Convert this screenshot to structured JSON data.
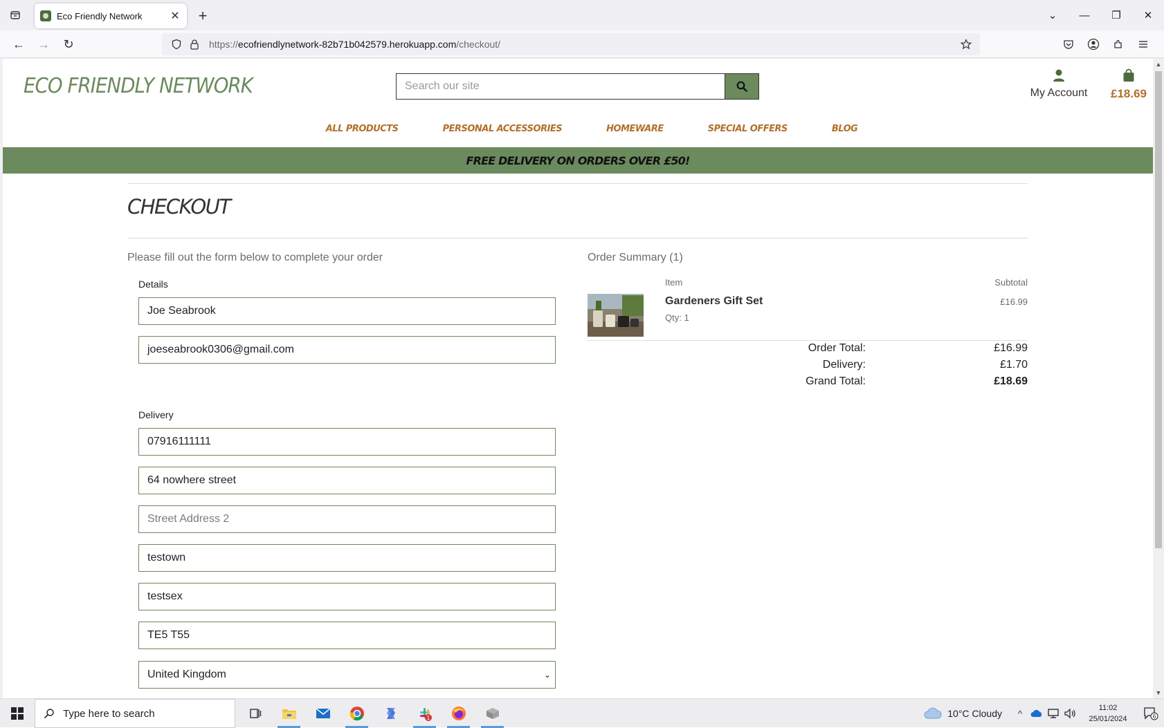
{
  "browser": {
    "tab_title": "Eco Friendly Network",
    "url_prefix": "https://",
    "url_host": "ecofriendlynetwork-82b71b042579.herokuapp.com",
    "url_path": "/checkout/"
  },
  "site": {
    "logo": "ECO FRIENDLY NETWORK",
    "search_placeholder": "Search our site",
    "account_label": "My Account",
    "bag_total": "£18.69",
    "nav": [
      "ALL PRODUCTS",
      "PERSONAL ACCESSORIES",
      "HOMEWARE",
      "SPECIAL OFFERS",
      "BLOG"
    ],
    "banner": "FREE DELIVERY ON ORDERS OVER £50!",
    "brand_color": "#6b8a5e",
    "accent_color": "#b2702a"
  },
  "checkout": {
    "title": "CHECKOUT",
    "intro": "Please fill out the form below to complete your order",
    "details_label": "Details",
    "full_name": "Joe Seabrook",
    "email": "joeseabrook0306@gmail.com",
    "delivery_label": "Delivery",
    "phone": "07916111111",
    "street1": "64 nowhere street",
    "street2_placeholder": "Street Address 2",
    "town": "testown",
    "county": "testsex",
    "postcode": "TE5 T55",
    "country": "United Kingdom"
  },
  "summary": {
    "title": "Order Summary (1)",
    "item_header": "Item",
    "subtotal_header": "Subtotal",
    "product_name": "Gardeners Gift Set",
    "product_qty": "Qty: 1",
    "product_subtotal": "£16.99",
    "order_total_label": "Order Total:",
    "order_total": "£16.99",
    "delivery_label": "Delivery:",
    "delivery": "£1.70",
    "grand_total_label": "Grand Total:",
    "grand_total": "£18.69"
  },
  "taskbar": {
    "search_text": "Type here to search",
    "weather": "10°C  Cloudy",
    "time": "11:02",
    "date": "25/01/2024",
    "notification_count": "6",
    "slack_badge": "1"
  }
}
